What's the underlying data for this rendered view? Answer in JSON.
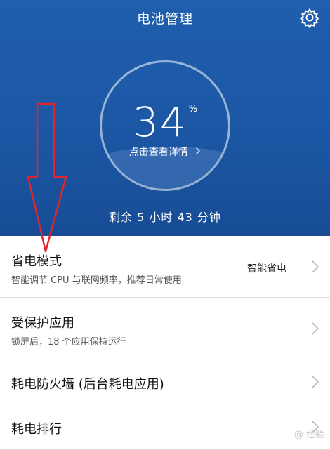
{
  "header": {
    "title": "电池管理",
    "battery_percent": "34",
    "percent_sign": "%",
    "detail_link": "点击查看详情",
    "remaining": "剩余 5 小时 43 分钟"
  },
  "icons": {
    "settings": "gear-icon",
    "chevron": "chevron-right-icon"
  },
  "list": [
    {
      "title": "省电模式",
      "subtitle": "智能调节 CPU 与联网频率，推荐日常使用",
      "value": "智能省电"
    },
    {
      "title": "受保护应用",
      "subtitle": "锁屏后，18 个应用保持运行"
    },
    {
      "title": "耗电防火墙 (后台耗电应用)"
    },
    {
      "title": "耗电排行"
    }
  ],
  "watermark": "@ 经验",
  "colors": {
    "header_bg": "#1c57a5",
    "annotation_arrow": "#e0262a"
  }
}
